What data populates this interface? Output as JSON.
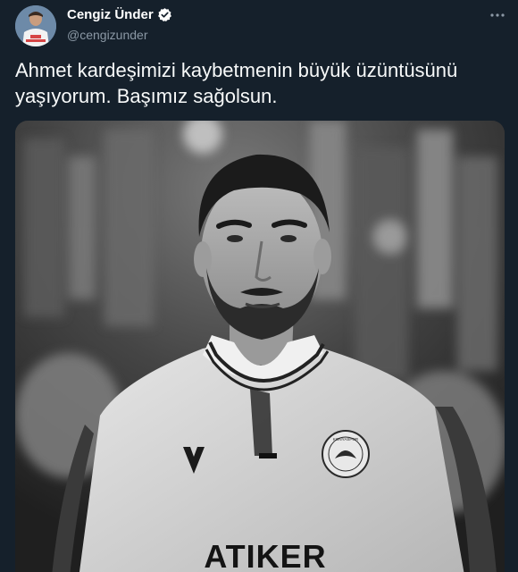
{
  "user": {
    "display_name": "Cengiz Ünder",
    "handle": "@cengizunder",
    "verified_icon": "verified-badge-icon",
    "avatar_icon": "profile-avatar"
  },
  "header": {
    "more_icon": "more-options-icon"
  },
  "tweet": {
    "text_line1": "Ahmet kardeşimizi kaybetmenin büyük üzüntüsünü",
    "text_line2": "yaşıyorum. Başımız sağolsun."
  },
  "media": {
    "description_icon": "black-and-white-football-player-photo",
    "shirt_sponsor": "ATIKER",
    "badge_text": "KONYASPOR"
  },
  "colors": {
    "background": "#15202b",
    "text": "#f7f9f9",
    "secondary": "#8b98a5",
    "verified": "#ffffff"
  }
}
